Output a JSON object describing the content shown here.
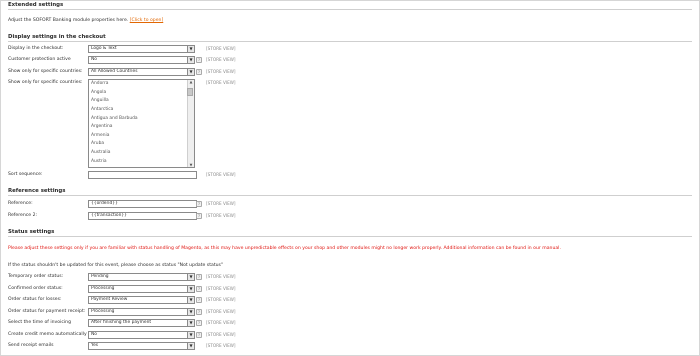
{
  "extended": {
    "title": "Extended settings",
    "intro_text": "Adjust the SOFORT Banking module properties here.",
    "intro_link": "[Click to open]"
  },
  "display": {
    "title": "Display settings in the checkout",
    "rows": [
      {
        "label": "Display in the checkout:",
        "value": "Logo & Text",
        "scope": "[STORE VIEW]"
      },
      {
        "label": "Customer protection active",
        "value": "No",
        "scope": "[STORE VIEW]"
      },
      {
        "label": "Show only for specific countries:",
        "value": "All Allowed Countries",
        "scope": "[STORE VIEW]"
      }
    ],
    "countries_label": "Show only for specific countries:",
    "countries_scope": "[STORE VIEW]",
    "countries": [
      "Andorra",
      "Angola",
      "Anguilla",
      "Antarctica",
      "Antigua and Barbuda",
      "Argentina",
      "Armenia",
      "Aruba",
      "Australia",
      "Austria"
    ],
    "sort_label": "Sort sequence:",
    "sort_value": "",
    "sort_scope": "[STORE VIEW]"
  },
  "reference": {
    "title": "Reference settings",
    "rows": [
      {
        "label": "Reference:",
        "value": "{{orderid}}",
        "scope": "[STORE VIEW]"
      },
      {
        "label": "Reference 2:",
        "value": "{{transaction}}",
        "scope": "[STORE VIEW]"
      }
    ]
  },
  "status": {
    "title": "Status settings",
    "warning": "Please adjust these settings only if you are familiar with status handling of Magento, as this may have unpredictable effects on your shop and other modules might no longer work properly. Additional information can be found in our manual.",
    "note": "If the status shouldn't be updated for this event, please choose as status \"Not update status\"",
    "rows": [
      {
        "label": "Temporary order status:",
        "value": "Pending",
        "scope": "[STORE VIEW]"
      },
      {
        "label": "Confirmed order status:",
        "value": "Processing",
        "scope": "[STORE VIEW]"
      },
      {
        "label": "Order status for losses:",
        "value": "Payment Review",
        "scope": "[STORE VIEW]"
      },
      {
        "label": "Order status for payment receipt:",
        "value": "Processing",
        "scope": "[STORE VIEW]"
      },
      {
        "label": "Select the time of invoicing",
        "value": "After finishing the payment",
        "scope": "[STORE VIEW]"
      },
      {
        "label": "Create credit memo automatically",
        "value": "No",
        "scope": "[STORE VIEW]"
      },
      {
        "label": "Send receipt emails",
        "value": "Yes",
        "scope": "[STORE VIEW]"
      }
    ]
  },
  "icons": {
    "help": "?",
    "dropdown": "▼",
    "scroll_up": "▲",
    "scroll_down": "▼"
  }
}
